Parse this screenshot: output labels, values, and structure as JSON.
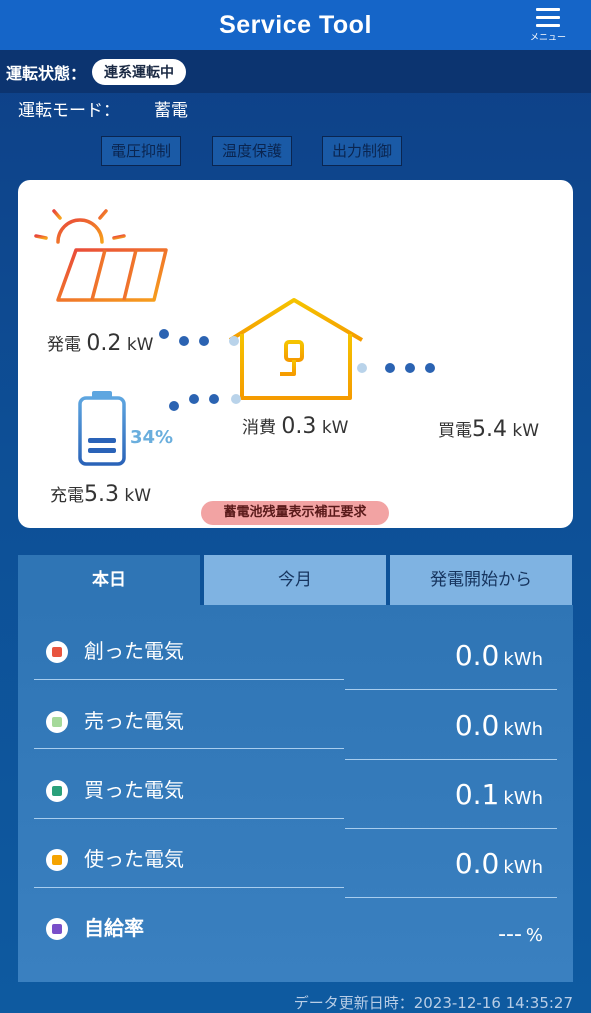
{
  "header": {
    "title": "Service Tool",
    "menu_label": "メニュー"
  },
  "status": {
    "label": "運転状態：",
    "value": "連系運転中"
  },
  "mode": {
    "label": "運転モード：",
    "value": "蓄電"
  },
  "flags": [
    "電圧抑制",
    "温度保護",
    "出力制御"
  ],
  "energy": {
    "generation": {
      "label": "発電",
      "value": "0.2",
      "unit": "kW"
    },
    "consumption": {
      "label": "消費",
      "value": "0.3",
      "unit": "kW"
    },
    "purchase": {
      "label": "買電",
      "value": "5.4",
      "unit": "kW"
    },
    "charge": {
      "label": "充電",
      "value": "5.3",
      "unit": "kW"
    },
    "battery_percent": "34%",
    "warning": "蓄電池残量表示補正要求"
  },
  "tabs": [
    {
      "label": "本日",
      "active": true
    },
    {
      "label": "今月",
      "active": false
    },
    {
      "label": "発電開始から",
      "active": false
    }
  ],
  "stats": [
    {
      "label": "創った電気",
      "value": "0.0",
      "unit": "kWh",
      "color": "#e8543e"
    },
    {
      "label": "売った電気",
      "value": "0.0",
      "unit": "kWh",
      "color": "#a5d99a"
    },
    {
      "label": "買った電気",
      "value": "0.1",
      "unit": "kWh",
      "color": "#2aa07a"
    },
    {
      "label": "使った電気",
      "value": "0.0",
      "unit": "kWh",
      "color": "#f5a300"
    },
    {
      "label": "自給率",
      "value": "---",
      "unit": "%",
      "color": "#7a4fc9"
    }
  ],
  "update": "データ更新日時：2023-12-16 14:35:27"
}
